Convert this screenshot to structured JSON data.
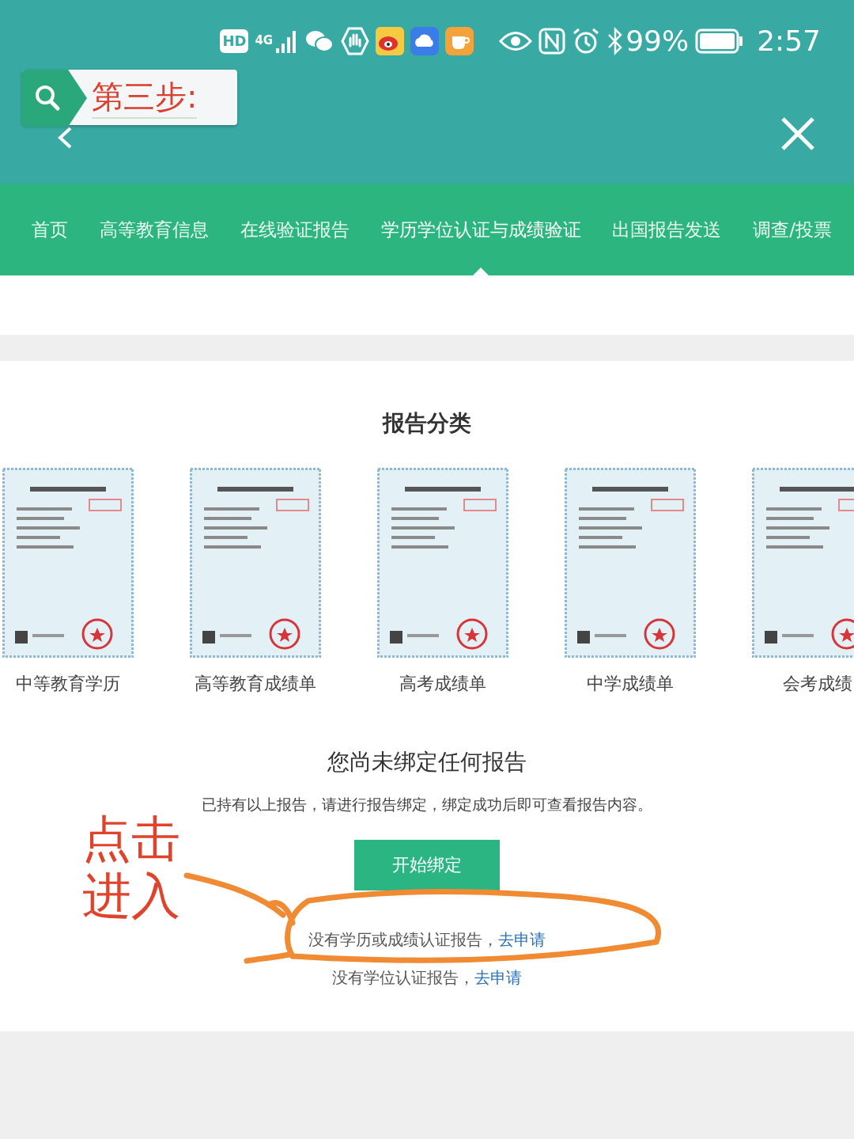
{
  "status_bar": {
    "hd": "HD",
    "network": "4G",
    "battery": "99%",
    "time": "2:57"
  },
  "step_callout": {
    "text": "第三步:"
  },
  "nav_tabs": [
    {
      "label": "首页",
      "selected": false
    },
    {
      "label": "高等教育信息",
      "selected": false
    },
    {
      "label": "在线验证报告",
      "selected": false
    },
    {
      "label": "学历学位认证与成绩验证",
      "selected": true
    },
    {
      "label": "出国报告发送",
      "selected": false
    },
    {
      "label": "调查/投票",
      "selected": false
    }
  ],
  "section_title": "报告分类",
  "reports": [
    {
      "kind": "picture",
      "label": "中等教育学历"
    },
    {
      "kind": "picture",
      "label": "高等教育成绩单"
    },
    {
      "kind": "picture",
      "label": "高考成绩单"
    },
    {
      "kind": "picture",
      "label": "中学成绩单"
    },
    {
      "kind": "picture",
      "label": "会考成绩"
    }
  ],
  "empty_state": {
    "title": "您尚未绑定任何报告",
    "description": "已持有以上报告，请进行报告绑定，绑定成功后即可查看报告内容。",
    "button": "开始绑定",
    "links": [
      {
        "text": "没有学历或成绩认证报告，",
        "link": "去申请"
      },
      {
        "text": "没有学位认证报告，",
        "link": "去申请"
      }
    ]
  },
  "annotation_note": {
    "lines": [
      "点击",
      "进入"
    ]
  }
}
